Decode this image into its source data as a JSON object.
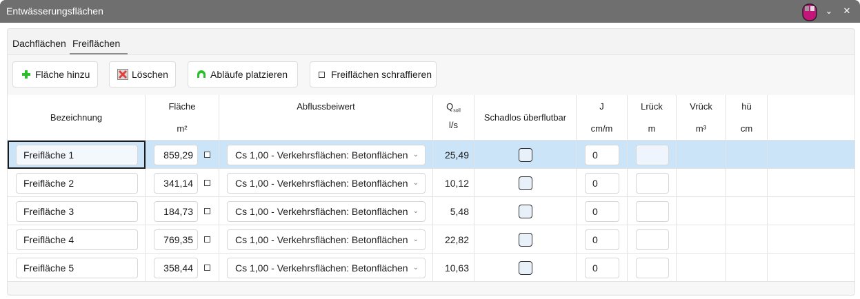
{
  "window": {
    "title": "Entwässerungsflächen",
    "chevron_glyph": "⌄",
    "close_glyph": "✕"
  },
  "tabs": [
    {
      "label": "Dachflächen"
    },
    {
      "label": "Freiflächen"
    }
  ],
  "toolbar": {
    "add_label": "Fläche hinzu",
    "delete_label": "Löschen",
    "place_label": "Abläufe platzieren",
    "hatch_label": "Freiflächen schraffieren"
  },
  "columns": {
    "bezeichnung": "Bezeichnung",
    "flaeche": "Fläche",
    "flaeche_unit": "m²",
    "abfluss": "Abflussbeiwert",
    "qsoll_q": "Q",
    "qsoll_sub": "soll",
    "qsoll_unit": "l/s",
    "schadlos": "Schadlos überflutbar",
    "j": "J",
    "j_unit": "cm/m",
    "lrueck": "Lrück",
    "lrueck_unit": "m",
    "vrueck": "Vrück",
    "vrueck_unit": "m³",
    "hue": "hü",
    "hue_unit": "cm"
  },
  "rows": [
    {
      "name": "Freifläche 1",
      "flaeche": "859,29",
      "abfluss": "Cs 1,00 - Verkehrsflächen: Betonflächen",
      "qsoll": "25,49",
      "j": "0"
    },
    {
      "name": "Freifläche 2",
      "flaeche": "341,14",
      "abfluss": "Cs 1,00 - Verkehrsflächen: Betonflächen",
      "qsoll": "10,12",
      "j": "0"
    },
    {
      "name": "Freifläche 3",
      "flaeche": "184,73",
      "abfluss": "Cs 1,00 - Verkehrsflächen: Betonflächen",
      "qsoll": "5,48",
      "j": "0"
    },
    {
      "name": "Freifläche 4",
      "flaeche": "769,35",
      "abfluss": "Cs 1,00 - Verkehrsflächen: Betonflächen",
      "qsoll": "22,82",
      "j": "0"
    },
    {
      "name": "Freifläche 5",
      "flaeche": "358,44",
      "abfluss": "Cs 1,00 - Verkehrsflächen: Betonflächen",
      "qsoll": "10,63",
      "j": "0"
    }
  ],
  "colors": {
    "titlebar": "#6f6f6f",
    "selected_row": "#cce4f7",
    "accent_green": "#2bbf2b",
    "app_icon": "#c4157a"
  }
}
